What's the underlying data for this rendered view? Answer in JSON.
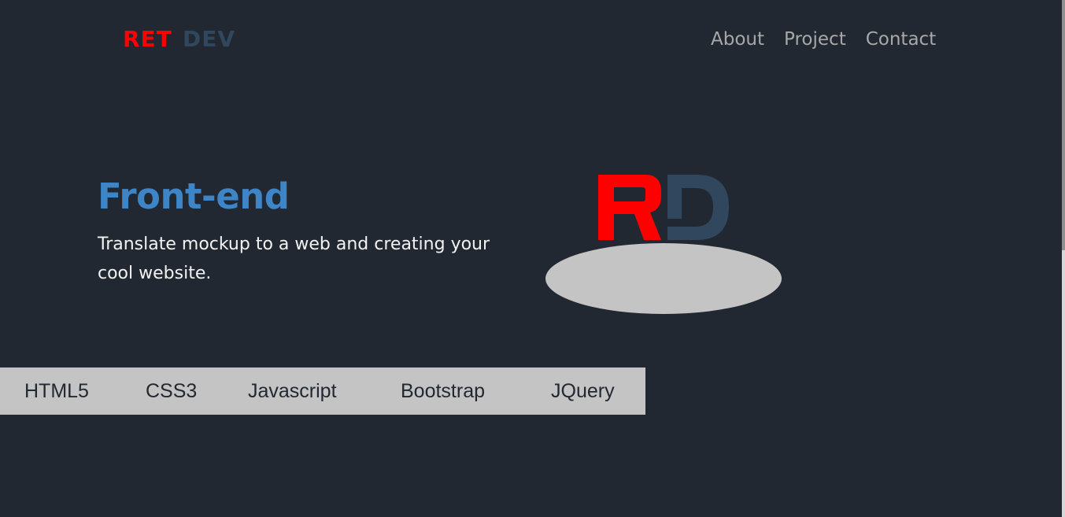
{
  "header": {
    "logo": {
      "part1": "RET",
      "part2": "DEV",
      "red": "#fe0000",
      "blue": "#30475e"
    },
    "nav": [
      {
        "label": "About"
      },
      {
        "label": "Project"
      },
      {
        "label": "Contact"
      }
    ]
  },
  "hero": {
    "title": "Front-end",
    "text": "Translate mockup to a web and creating your cool website.",
    "illustration": {
      "letters": "RD",
      "red": "#fe0000",
      "blue": "#30475e",
      "shadow_color": "#c4c4c4"
    }
  },
  "skills": [
    {
      "label": "HTML5"
    },
    {
      "label": "CSS3"
    },
    {
      "label": "Javascript"
    },
    {
      "label": "Bootstrap"
    },
    {
      "label": "JQuery"
    }
  ],
  "colors": {
    "background": "#222831",
    "accent": "#3d85c6",
    "nav_text": "#a8a8a8",
    "skills_bar": "#c4c4c4"
  }
}
